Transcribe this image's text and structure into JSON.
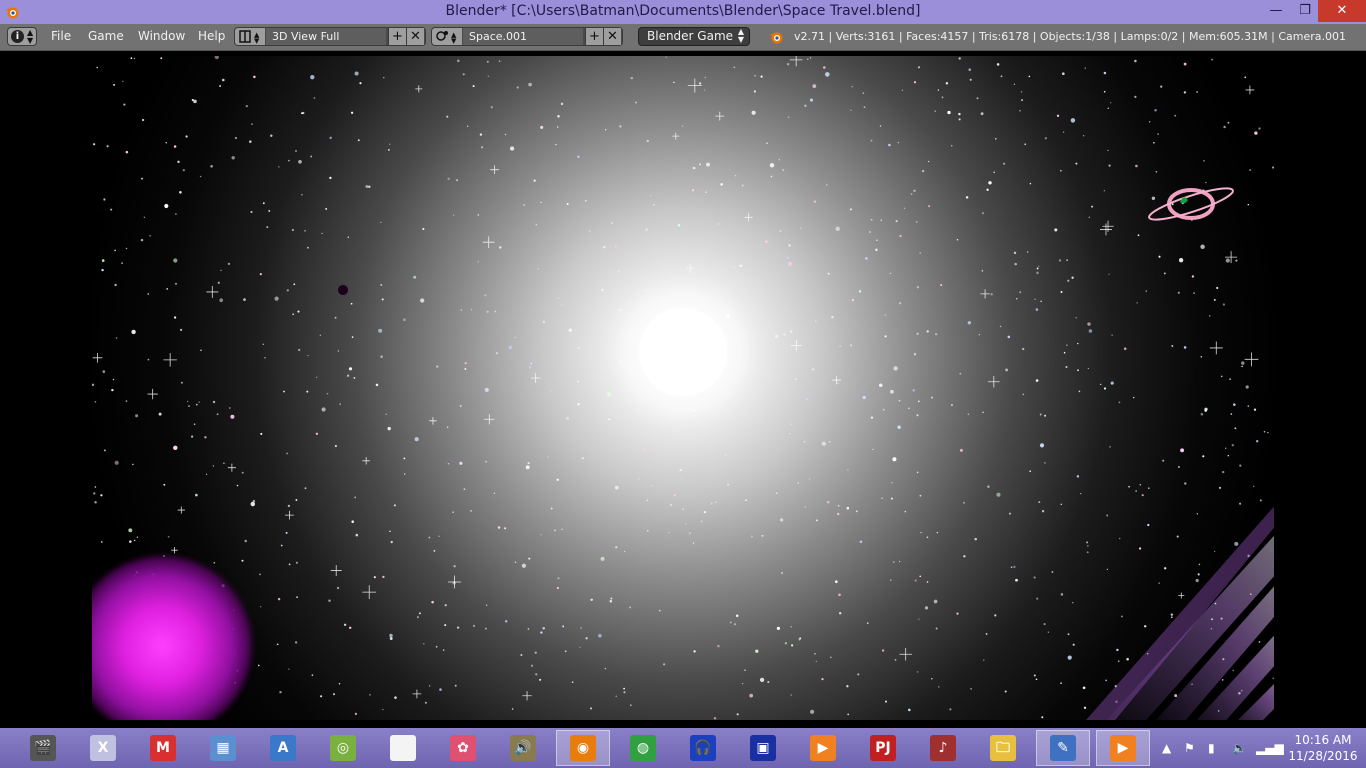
{
  "window": {
    "title": "Blender* [C:\\Users\\Batman\\Documents\\Blender\\Space Travel.blend]",
    "minimize_glyph": "—",
    "maximize_glyph": "❐",
    "close_glyph": "✕"
  },
  "header": {
    "menus": [
      "File",
      "Game",
      "Window",
      "Help"
    ],
    "screen_layout": "3D View Full",
    "scene": "Space.001",
    "engine": "Blender Game",
    "stats": "v2.71 | Verts:3161 | Faces:4157 | Tris:6178 | Objects:1/38 | Lamps:0/2 | Mem:605.31M | Camera.001",
    "add_glyph": "+",
    "remove_glyph": "✕",
    "info_glyph": "i"
  },
  "viewport": {
    "scene_description_icons": [
      "sun",
      "ringed-planet",
      "nebula",
      "light-streaks",
      "dark-moon"
    ]
  },
  "taskbar": {
    "apps": [
      {
        "name": "video-maker-icon",
        "glyph": "🎬",
        "color": "#555555"
      },
      {
        "name": "game-icon",
        "glyph": "X",
        "color": "#c0c0e0"
      },
      {
        "name": "mario-icon",
        "glyph": "M",
        "color": "#d83030"
      },
      {
        "name": "calculator-icon",
        "glyph": "▦",
        "color": "#5a8fd0"
      },
      {
        "name": "wordpad-icon",
        "glyph": "A",
        "color": "#3a78c8"
      },
      {
        "name": "green-app-icon",
        "glyph": "◎",
        "color": "#7ab040"
      },
      {
        "name": "document-icon",
        "glyph": "",
        "color": "#f4f4f4"
      },
      {
        "name": "paint-icon",
        "glyph": "✿",
        "color": "#e05070"
      },
      {
        "name": "audio-icon",
        "glyph": "🔊",
        "color": "#8a7a50"
      },
      {
        "name": "blender-icon",
        "glyph": "◉",
        "color": "#e87d0d"
      },
      {
        "name": "chrome-icon",
        "glyph": "◍",
        "color": "#30a040"
      },
      {
        "name": "audacity-icon",
        "glyph": "🎧",
        "color": "#1a40c0"
      },
      {
        "name": "blue-app-icon",
        "glyph": "▣",
        "color": "#1830a0"
      },
      {
        "name": "media-player-icon",
        "glyph": "▶",
        "color": "#f08020"
      },
      {
        "name": "project64-icon",
        "glyph": "PJ",
        "color": "#c02020"
      },
      {
        "name": "piano-icon",
        "glyph": "♪",
        "color": "#a03030"
      },
      {
        "name": "file-explorer-icon",
        "glyph": "🗀",
        "color": "#e8c040"
      },
      {
        "name": "editor-icon",
        "glyph": "✎",
        "color": "#4070c0"
      },
      {
        "name": "media-player-2-icon",
        "glyph": "▶",
        "color": "#f08020"
      }
    ],
    "time": "10:16 AM",
    "date": "11/28/2016"
  }
}
